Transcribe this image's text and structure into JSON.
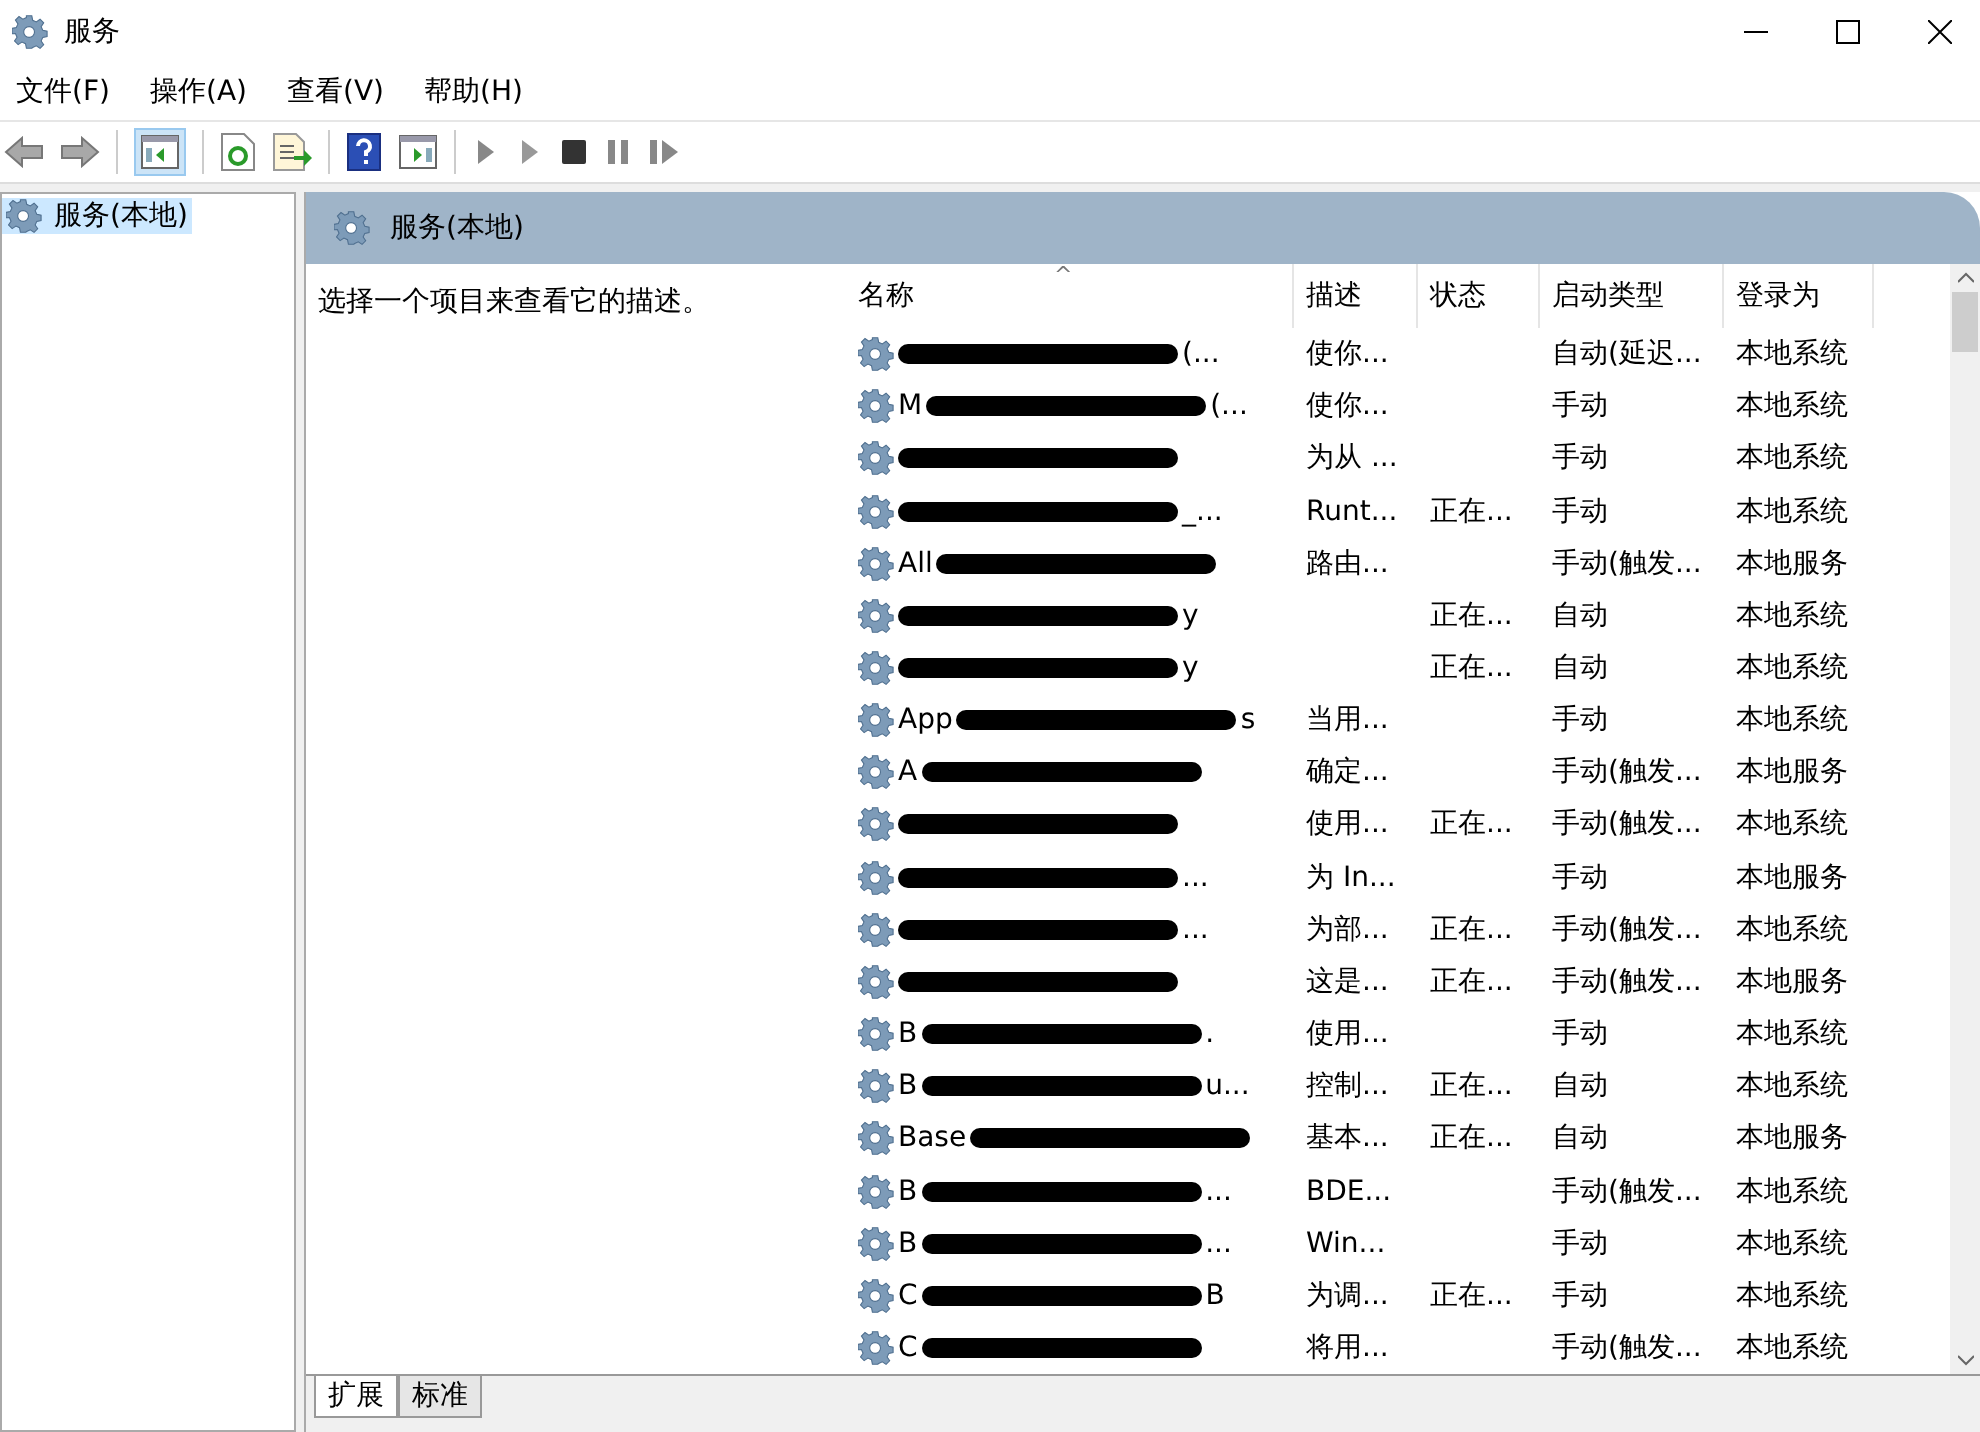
{
  "window": {
    "title": "服务"
  },
  "menu": [
    "文件(F)",
    "操作(A)",
    "查看(V)",
    "帮助(H)"
  ],
  "tree": {
    "items": [
      {
        "label": "服务(本地)",
        "selected": true
      }
    ]
  },
  "pane": {
    "title": "服务(本地)",
    "description": "选择一个项目来查看它的描述。"
  },
  "table": {
    "sort_caret": "^",
    "columns": [
      "名称",
      "描述",
      "状态",
      "启动类型",
      "登录为"
    ],
    "rows": [
      {
        "name_prefix": "",
        "name_suffix": "(...",
        "description": "使你...",
        "status": "",
        "startup": "自动(延迟...",
        "logon": "本地系统"
      },
      {
        "name_prefix": "M",
        "name_suffix": "(...",
        "description": "使你...",
        "status": "",
        "startup": "手动",
        "logon": "本地系统"
      },
      {
        "name_prefix": "",
        "name_suffix": "",
        "description": "为从 ...",
        "status": "",
        "startup": "手动",
        "logon": "本地系统"
      },
      {
        "name_prefix": "",
        "name_suffix": "_...",
        "description": "Runt...",
        "status": "正在...",
        "startup": "手动",
        "logon": "本地系统"
      },
      {
        "name_prefix": "All",
        "name_suffix": "",
        "description": "路由...",
        "status": "",
        "startup": "手动(触发...",
        "logon": "本地服务"
      },
      {
        "name_prefix": "",
        "name_suffix": "y",
        "description": "",
        "status": "正在...",
        "startup": "自动",
        "logon": "本地系统"
      },
      {
        "name_prefix": "",
        "name_suffix": "y",
        "description": "",
        "status": "正在...",
        "startup": "自动",
        "logon": "本地系统"
      },
      {
        "name_prefix": "App",
        "name_suffix": "s",
        "description": "当用...",
        "status": "",
        "startup": "手动",
        "logon": "本地系统"
      },
      {
        "name_prefix": "A",
        "name_suffix": "",
        "description": "确定...",
        "status": "",
        "startup": "手动(触发...",
        "logon": "本地服务"
      },
      {
        "name_prefix": "",
        "name_suffix": "",
        "description": "使用...",
        "status": "正在...",
        "startup": "手动(触发...",
        "logon": "本地系统"
      },
      {
        "name_prefix": "",
        "name_suffix": "...",
        "description": "为 In...",
        "status": "",
        "startup": "手动",
        "logon": "本地服务"
      },
      {
        "name_prefix": "",
        "name_suffix": "...",
        "description": "为部...",
        "status": "正在...",
        "startup": "手动(触发...",
        "logon": "本地系统"
      },
      {
        "name_prefix": "",
        "name_suffix": "",
        "description": "这是...",
        "status": "正在...",
        "startup": "手动(触发...",
        "logon": "本地服务"
      },
      {
        "name_prefix": "B",
        "name_suffix": ".",
        "description": "使用...",
        "status": "",
        "startup": "手动",
        "logon": "本地系统"
      },
      {
        "name_prefix": "B",
        "name_suffix": "u...",
        "description": "控制...",
        "status": "正在...",
        "startup": "自动",
        "logon": "本地系统"
      },
      {
        "name_prefix": "Base",
        "name_suffix": "",
        "description": "基本...",
        "status": "正在...",
        "startup": "自动",
        "logon": "本地服务"
      },
      {
        "name_prefix": "B",
        "name_suffix": "...",
        "description": "BDE...",
        "status": "",
        "startup": "手动(触发...",
        "logon": "本地系统"
      },
      {
        "name_prefix": "B",
        "name_suffix": "...",
        "description": "Win...",
        "status": "",
        "startup": "手动",
        "logon": "本地系统"
      },
      {
        "name_prefix": "C",
        "name_suffix": "B",
        "description": "为调...",
        "status": "正在...",
        "startup": "手动",
        "logon": "本地系统"
      },
      {
        "name_prefix": "C",
        "name_suffix": "",
        "description": "将用...",
        "status": "",
        "startup": "手动(触发...",
        "logon": "本地系统"
      }
    ]
  },
  "view_tabs": [
    {
      "label": "扩展",
      "selected": true
    },
    {
      "label": "标准",
      "selected": false
    }
  ]
}
